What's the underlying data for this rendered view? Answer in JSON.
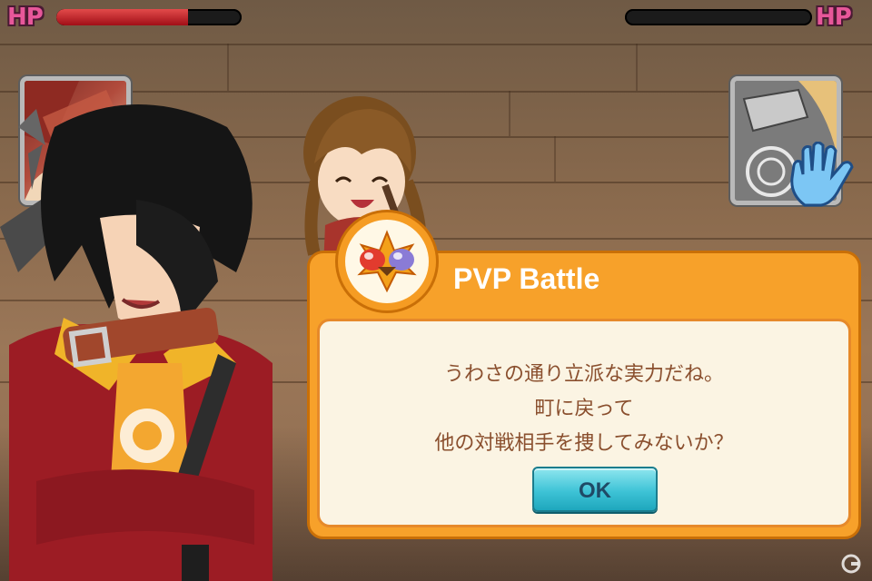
{
  "hud": {
    "player_hp_label": "HP",
    "enemy_hp_label": "HP",
    "player_hp_fraction": 0.71,
    "enemy_hp_fraction": 0.0
  },
  "dialog": {
    "title": "PVP Battle",
    "message_lines": [
      "うわさの通り立派な実力だね。",
      "町に戻って",
      "他の対戦相手を捜してみないか？"
    ],
    "ok_label": "OK"
  },
  "icons": {
    "badge": "pvp-battle-emblem-icon",
    "skill_left": "skill-portrait-icon",
    "skill_right": "skill-portrait-icon",
    "hand": "hand-icon",
    "watermark": "gamer-logo-icon"
  },
  "colors": {
    "hp_label": "#e7579a",
    "hp_fill": "#c0161f",
    "dialog_frame": "#f7a12a",
    "dialog_body": "#fbf4e3",
    "message_text": "#8a4f2e",
    "ok_button": "#3ec3d6"
  }
}
